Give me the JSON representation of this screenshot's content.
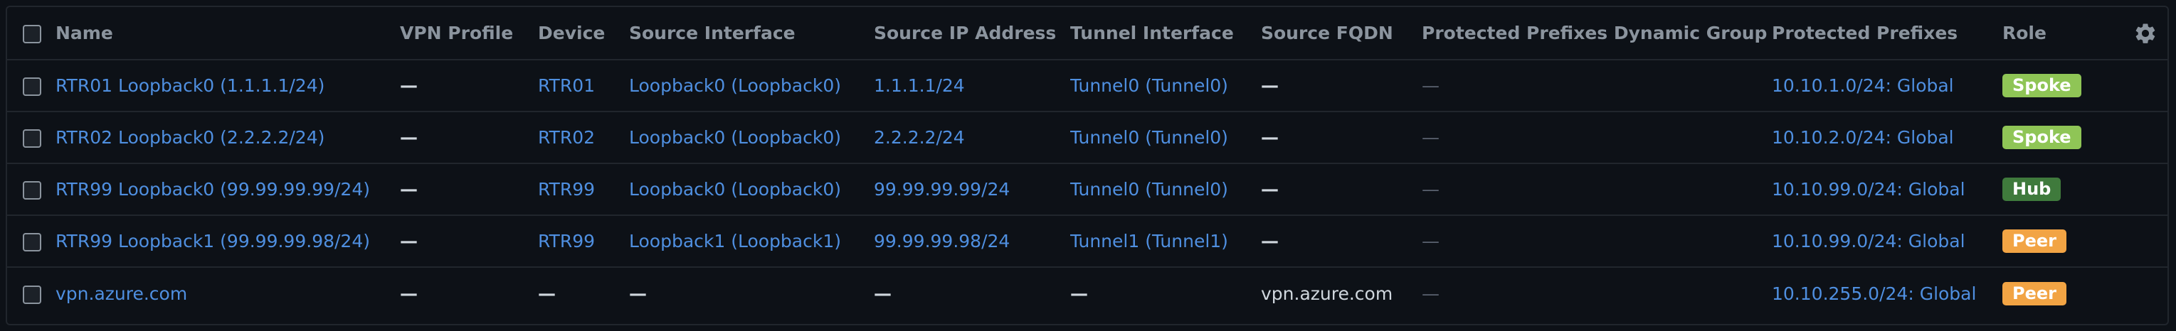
{
  "headers": {
    "name": "Name",
    "vpn_profile": "VPN Profile",
    "device": "Device",
    "source_interface": "Source Interface",
    "source_ip": "Source IP Address",
    "tunnel_interface": "Tunnel Interface",
    "source_fqdn": "Source FQDN",
    "protected_prefixes_dg": "Protected Prefixes Dynamic Group",
    "protected_prefixes": "Protected Prefixes",
    "role": "Role"
  },
  "icons": {
    "header_settings": "gear-icon"
  },
  "colors": {
    "spoke": "#8fc556",
    "hub": "#3f7a3c",
    "peer": "#f2a444",
    "link": "#4f8fe0"
  },
  "rows": [
    {
      "name": "RTR01 Loopback0 (1.1.1.1/24)",
      "vpn_profile": "—",
      "device": "RTR01",
      "source_interface": "Loopback0 (Loopback0)",
      "source_ip": "1.1.1.1/24",
      "tunnel_interface": "Tunnel0 (Tunnel0)",
      "source_fqdn": "—",
      "protected_prefixes_dg": "—",
      "protected_prefixes": "10.10.1.0/24: Global",
      "role": "Spoke"
    },
    {
      "name": "RTR02 Loopback0 (2.2.2.2/24)",
      "vpn_profile": "—",
      "device": "RTR02",
      "source_interface": "Loopback0 (Loopback0)",
      "source_ip": "2.2.2.2/24",
      "tunnel_interface": "Tunnel0 (Tunnel0)",
      "source_fqdn": "—",
      "protected_prefixes_dg": "—",
      "protected_prefixes": "10.10.2.0/24: Global",
      "role": "Spoke"
    },
    {
      "name": "RTR99 Loopback0 (99.99.99.99/24)",
      "vpn_profile": "—",
      "device": "RTR99",
      "source_interface": "Loopback0 (Loopback0)",
      "source_ip": "99.99.99.99/24",
      "tunnel_interface": "Tunnel0 (Tunnel0)",
      "source_fqdn": "—",
      "protected_prefixes_dg": "—",
      "protected_prefixes": "10.10.99.0/24: Global",
      "role": "Hub"
    },
    {
      "name": "RTR99 Loopback1 (99.99.99.98/24)",
      "vpn_profile": "—",
      "device": "RTR99",
      "source_interface": "Loopback1 (Loopback1)",
      "source_ip": "99.99.99.98/24",
      "tunnel_interface": "Tunnel1 (Tunnel1)",
      "source_fqdn": "—",
      "protected_prefixes_dg": "—",
      "protected_prefixes": "10.10.99.0/24: Global",
      "role": "Peer"
    },
    {
      "name": "vpn.azure.com",
      "vpn_profile": "—",
      "device": "—",
      "source_interface": "—",
      "source_ip": "—",
      "tunnel_interface": "—",
      "source_fqdn": "vpn.azure.com",
      "protected_prefixes_dg": "—",
      "protected_prefixes": "10.10.255.0/24: Global",
      "role": "Peer"
    }
  ]
}
